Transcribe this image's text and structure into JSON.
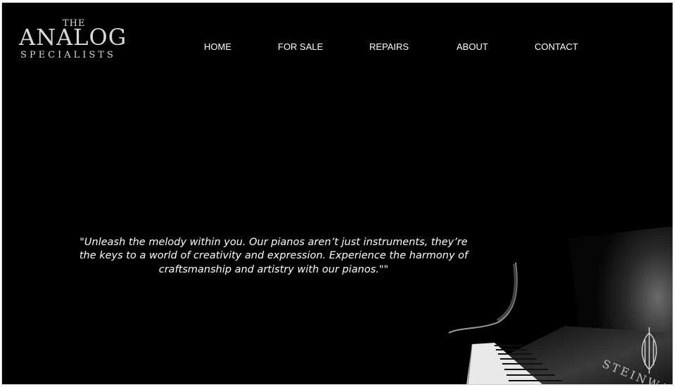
{
  "brand": {
    "logo_top": "THE",
    "logo_main": "ANALOG",
    "logo_bottom": "SPECIALISTS"
  },
  "nav": {
    "items": [
      {
        "label": "HOME"
      },
      {
        "label": "FOR SALE"
      },
      {
        "label": "REPAIRS"
      },
      {
        "label": "ABOUT"
      },
      {
        "label": "CONTACT"
      }
    ]
  },
  "hero": {
    "quote": "\"Unleash the melody within you. Our pianos aren’t just instruments, they’re the keys to a world of creativity and expression. Experience the harmony of craftsmanship and artistry with our pianos.\"\"",
    "brand_mark": "STEINWAY"
  },
  "colors": {
    "background": "#000000",
    "text": "#ffffff",
    "logo": "#d9d9d9"
  }
}
